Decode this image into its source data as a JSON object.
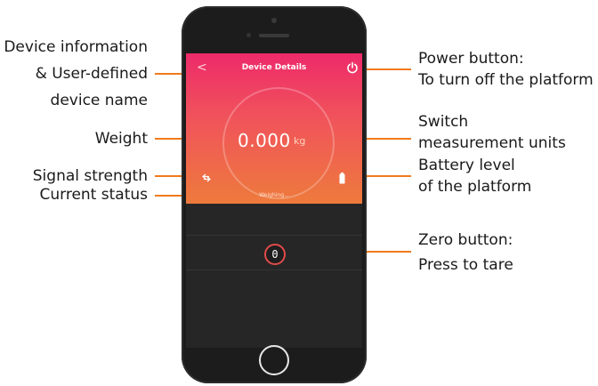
{
  "annotations": {
    "device_info": [
      "Device information",
      "& User-defined",
      "device name"
    ],
    "weight": "Weight",
    "signal": "Signal strength",
    "status": "Current status",
    "power": [
      "Power button:",
      "To turn off the platform"
    ],
    "units": [
      "Switch",
      "measurement units"
    ],
    "battery": [
      "Battery level",
      "of the platform"
    ],
    "zero": [
      "Zero button:",
      "Press to tare"
    ]
  },
  "screen": {
    "back_glyph": "<",
    "title": "Device Details",
    "weight_value": "0.000",
    "unit": "kg",
    "status_text": "Weighing...",
    "zero_label": "0"
  },
  "colors": {
    "accent": "#f07a1c",
    "gradient_top": "#ee2a6a",
    "gradient_bottom": "#ee7a3c"
  },
  "icons": [
    "power-icon",
    "signal-icon",
    "battery-icon",
    "back-icon",
    "home-button"
  ]
}
